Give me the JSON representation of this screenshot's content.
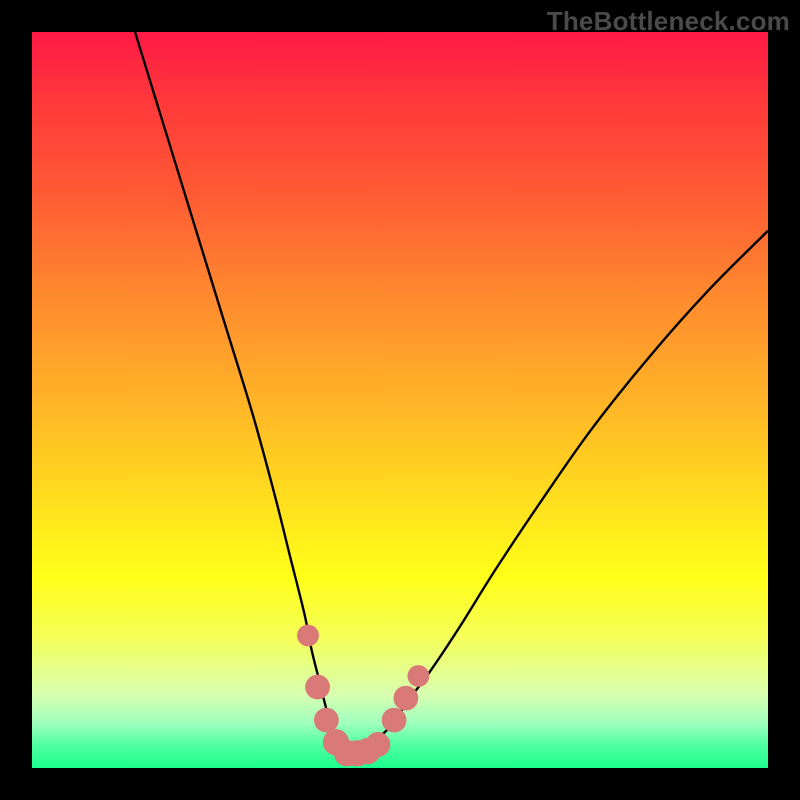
{
  "watermark": "TheBottleneck.com",
  "colors": {
    "curve_stroke": "#000000",
    "marker_fill": "#d97a78",
    "marker_stroke": "#d97a78"
  },
  "chart_data": {
    "type": "line",
    "title": "",
    "xlabel": "",
    "ylabel": "",
    "xlim": [
      0,
      100
    ],
    "ylim": [
      0,
      100
    ],
    "grid": false,
    "series": [
      {
        "name": "bottleneck-curve",
        "x": [
          14,
          18,
          22,
          26,
          30,
          33,
          35,
          37,
          38,
          39,
          40,
          41,
          42,
          43,
          44,
          45,
          46,
          47,
          49,
          51,
          54,
          58,
          63,
          69,
          76,
          84,
          92,
          100
        ],
        "y": [
          100,
          87,
          74,
          61,
          48,
          37,
          29,
          21,
          16,
          12,
          8,
          5,
          3,
          2,
          2,
          2,
          3,
          4,
          6,
          9,
          13,
          19,
          27,
          36,
          46,
          56,
          65,
          73
        ]
      }
    ],
    "markers": [
      {
        "x": 37.5,
        "y": 18,
        "r": 1.2
      },
      {
        "x": 38.8,
        "y": 11,
        "r": 1.6
      },
      {
        "x": 40.0,
        "y": 6.5,
        "r": 1.6
      },
      {
        "x": 41.3,
        "y": 3.5,
        "r": 1.8
      },
      {
        "x": 42.8,
        "y": 2.0,
        "r": 1.8
      },
      {
        "x": 44.2,
        "y": 2.0,
        "r": 1.8
      },
      {
        "x": 45.6,
        "y": 2.3,
        "r": 1.8
      },
      {
        "x": 47.0,
        "y": 3.2,
        "r": 1.6
      },
      {
        "x": 49.2,
        "y": 6.5,
        "r": 1.6
      },
      {
        "x": 50.8,
        "y": 9.5,
        "r": 1.6
      },
      {
        "x": 52.5,
        "y": 12.5,
        "r": 1.2
      }
    ]
  }
}
